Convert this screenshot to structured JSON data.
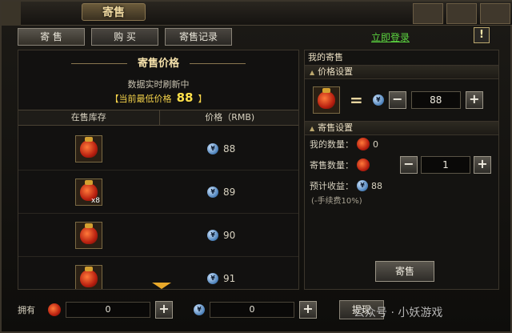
{
  "window": {
    "title": "寄售"
  },
  "tabs": [
    {
      "label": "寄 售"
    },
    {
      "label": "购 买"
    },
    {
      "label": "寄售记录"
    }
  ],
  "header": {
    "login_link": "立即登录",
    "alert_icon": "!"
  },
  "price_panel": {
    "title": "寄售价格",
    "refresh_text": "数据实时刷新中",
    "lowest_prefix": "【当前最低价格",
    "lowest_value": "88",
    "lowest_suffix": "】",
    "columns": [
      "在售库存",
      "价格（RMB)"
    ],
    "rows": [
      {
        "qty": "",
        "price": "88"
      },
      {
        "qty": "x8",
        "price": "89"
      },
      {
        "qty": "",
        "price": "90"
      },
      {
        "qty": "",
        "price": "91"
      }
    ]
  },
  "my_sale": {
    "title": "我的寄售",
    "price_section": "价格设置",
    "price_value": "88",
    "sale_section": "寄售设置",
    "my_qty_label": "我的数量：",
    "my_qty": "0",
    "sale_qty_label": "寄售数量：",
    "sale_qty": "1",
    "income_label": "预计收益：",
    "income": "88",
    "fee_note": "(-手续费10%)",
    "sell_button": "寄售"
  },
  "bottom": {
    "own_label": "拥有",
    "item_amount": "0",
    "coin_amount": "0",
    "withdraw_button": "提现"
  },
  "watermark": "公众号 · 小妖游戏"
}
